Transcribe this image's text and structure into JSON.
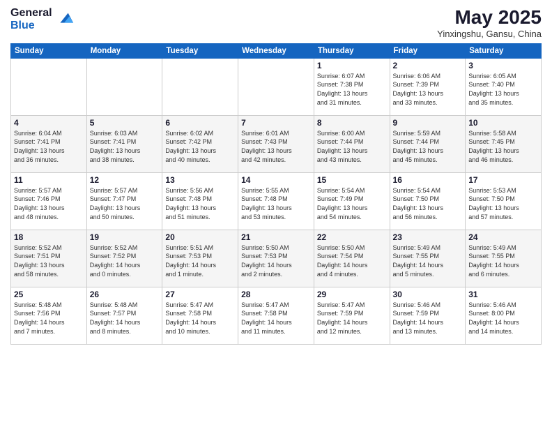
{
  "header": {
    "logo_general": "General",
    "logo_blue": "Blue",
    "title": "May 2025",
    "location": "Yinxingshu, Gansu, China"
  },
  "weekdays": [
    "Sunday",
    "Monday",
    "Tuesday",
    "Wednesday",
    "Thursday",
    "Friday",
    "Saturday"
  ],
  "rows": [
    [
      {
        "day": "",
        "info": ""
      },
      {
        "day": "",
        "info": ""
      },
      {
        "day": "",
        "info": ""
      },
      {
        "day": "",
        "info": ""
      },
      {
        "day": "1",
        "info": "Sunrise: 6:07 AM\nSunset: 7:38 PM\nDaylight: 13 hours\nand 31 minutes."
      },
      {
        "day": "2",
        "info": "Sunrise: 6:06 AM\nSunset: 7:39 PM\nDaylight: 13 hours\nand 33 minutes."
      },
      {
        "day": "3",
        "info": "Sunrise: 6:05 AM\nSunset: 7:40 PM\nDaylight: 13 hours\nand 35 minutes."
      }
    ],
    [
      {
        "day": "4",
        "info": "Sunrise: 6:04 AM\nSunset: 7:41 PM\nDaylight: 13 hours\nand 36 minutes."
      },
      {
        "day": "5",
        "info": "Sunrise: 6:03 AM\nSunset: 7:41 PM\nDaylight: 13 hours\nand 38 minutes."
      },
      {
        "day": "6",
        "info": "Sunrise: 6:02 AM\nSunset: 7:42 PM\nDaylight: 13 hours\nand 40 minutes."
      },
      {
        "day": "7",
        "info": "Sunrise: 6:01 AM\nSunset: 7:43 PM\nDaylight: 13 hours\nand 42 minutes."
      },
      {
        "day": "8",
        "info": "Sunrise: 6:00 AM\nSunset: 7:44 PM\nDaylight: 13 hours\nand 43 minutes."
      },
      {
        "day": "9",
        "info": "Sunrise: 5:59 AM\nSunset: 7:44 PM\nDaylight: 13 hours\nand 45 minutes."
      },
      {
        "day": "10",
        "info": "Sunrise: 5:58 AM\nSunset: 7:45 PM\nDaylight: 13 hours\nand 46 minutes."
      }
    ],
    [
      {
        "day": "11",
        "info": "Sunrise: 5:57 AM\nSunset: 7:46 PM\nDaylight: 13 hours\nand 48 minutes."
      },
      {
        "day": "12",
        "info": "Sunrise: 5:57 AM\nSunset: 7:47 PM\nDaylight: 13 hours\nand 50 minutes."
      },
      {
        "day": "13",
        "info": "Sunrise: 5:56 AM\nSunset: 7:48 PM\nDaylight: 13 hours\nand 51 minutes."
      },
      {
        "day": "14",
        "info": "Sunrise: 5:55 AM\nSunset: 7:48 PM\nDaylight: 13 hours\nand 53 minutes."
      },
      {
        "day": "15",
        "info": "Sunrise: 5:54 AM\nSunset: 7:49 PM\nDaylight: 13 hours\nand 54 minutes."
      },
      {
        "day": "16",
        "info": "Sunrise: 5:54 AM\nSunset: 7:50 PM\nDaylight: 13 hours\nand 56 minutes."
      },
      {
        "day": "17",
        "info": "Sunrise: 5:53 AM\nSunset: 7:50 PM\nDaylight: 13 hours\nand 57 minutes."
      }
    ],
    [
      {
        "day": "18",
        "info": "Sunrise: 5:52 AM\nSunset: 7:51 PM\nDaylight: 13 hours\nand 58 minutes."
      },
      {
        "day": "19",
        "info": "Sunrise: 5:52 AM\nSunset: 7:52 PM\nDaylight: 14 hours\nand 0 minutes."
      },
      {
        "day": "20",
        "info": "Sunrise: 5:51 AM\nSunset: 7:53 PM\nDaylight: 14 hours\nand 1 minute."
      },
      {
        "day": "21",
        "info": "Sunrise: 5:50 AM\nSunset: 7:53 PM\nDaylight: 14 hours\nand 2 minutes."
      },
      {
        "day": "22",
        "info": "Sunrise: 5:50 AM\nSunset: 7:54 PM\nDaylight: 14 hours\nand 4 minutes."
      },
      {
        "day": "23",
        "info": "Sunrise: 5:49 AM\nSunset: 7:55 PM\nDaylight: 14 hours\nand 5 minutes."
      },
      {
        "day": "24",
        "info": "Sunrise: 5:49 AM\nSunset: 7:55 PM\nDaylight: 14 hours\nand 6 minutes."
      }
    ],
    [
      {
        "day": "25",
        "info": "Sunrise: 5:48 AM\nSunset: 7:56 PM\nDaylight: 14 hours\nand 7 minutes."
      },
      {
        "day": "26",
        "info": "Sunrise: 5:48 AM\nSunset: 7:57 PM\nDaylight: 14 hours\nand 8 minutes."
      },
      {
        "day": "27",
        "info": "Sunrise: 5:47 AM\nSunset: 7:58 PM\nDaylight: 14 hours\nand 10 minutes."
      },
      {
        "day": "28",
        "info": "Sunrise: 5:47 AM\nSunset: 7:58 PM\nDaylight: 14 hours\nand 11 minutes."
      },
      {
        "day": "29",
        "info": "Sunrise: 5:47 AM\nSunset: 7:59 PM\nDaylight: 14 hours\nand 12 minutes."
      },
      {
        "day": "30",
        "info": "Sunrise: 5:46 AM\nSunset: 7:59 PM\nDaylight: 14 hours\nand 13 minutes."
      },
      {
        "day": "31",
        "info": "Sunrise: 5:46 AM\nSunset: 8:00 PM\nDaylight: 14 hours\nand 14 minutes."
      }
    ]
  ]
}
